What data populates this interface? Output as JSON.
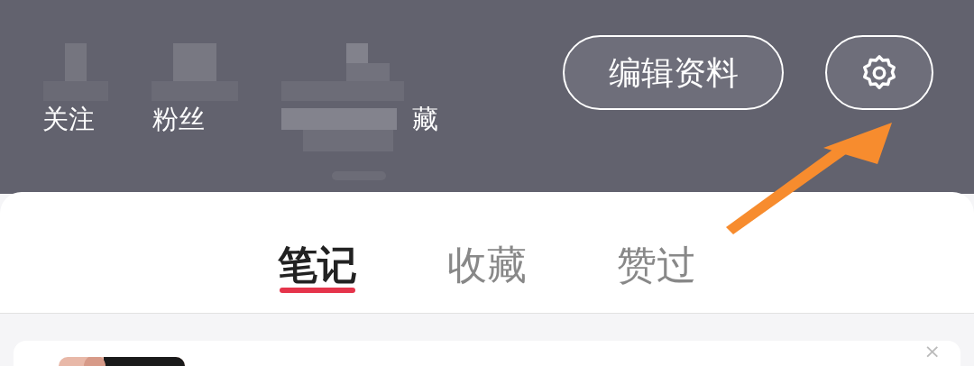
{
  "profile_stats": [
    {
      "label": "关注"
    },
    {
      "label": "粉丝"
    },
    {
      "label": "藏"
    }
  ],
  "buttons": {
    "edit_profile": "编辑资料"
  },
  "tabs": [
    {
      "label": "笔记",
      "selected": true
    },
    {
      "label": "收藏",
      "selected": false
    },
    {
      "label": "赞过",
      "selected": false
    }
  ],
  "note_card": {
    "close": "×"
  }
}
